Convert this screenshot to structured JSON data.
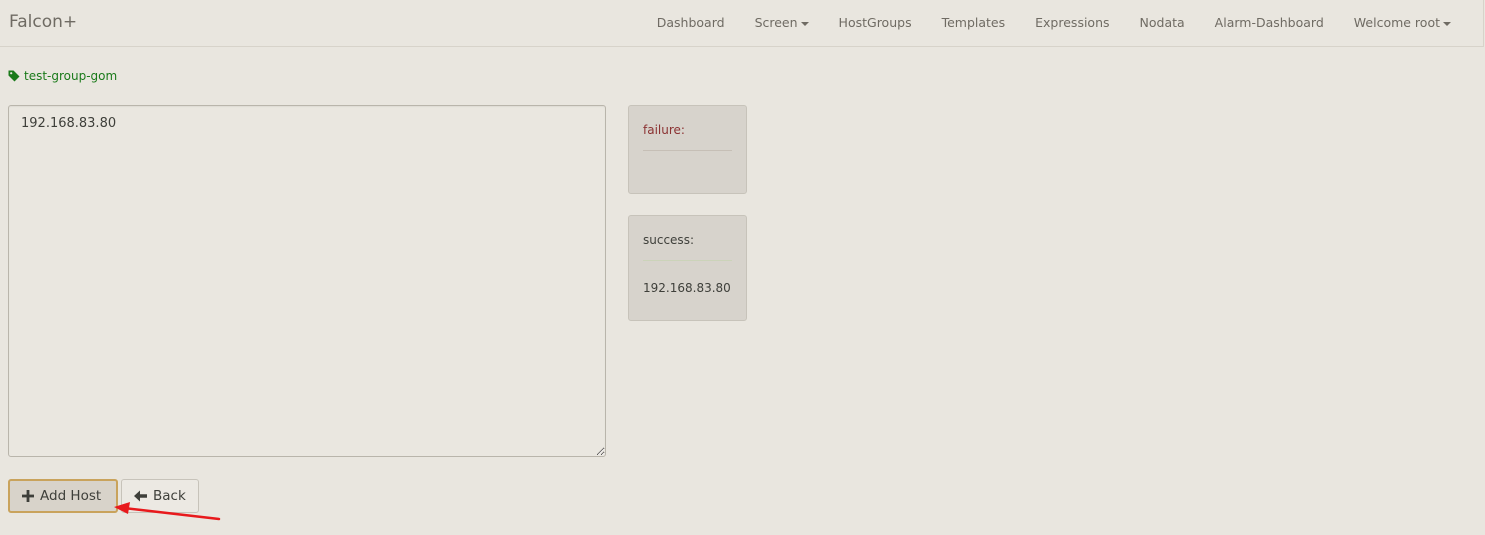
{
  "navbar": {
    "brand": "Falcon+",
    "items": [
      {
        "label": "Dashboard",
        "dropdown": false
      },
      {
        "label": "Screen",
        "dropdown": true
      },
      {
        "label": "HostGroups",
        "dropdown": false
      },
      {
        "label": "Templates",
        "dropdown": false
      },
      {
        "label": "Expressions",
        "dropdown": false
      },
      {
        "label": "Nodata",
        "dropdown": false
      },
      {
        "label": "Alarm-Dashboard",
        "dropdown": false
      },
      {
        "label": "Welcome root",
        "dropdown": true
      }
    ]
  },
  "group": {
    "name": "test-group-gom",
    "icon": "tag-icon",
    "color": "#1a7a1a"
  },
  "hosts_input": {
    "value": "192.168.83.80"
  },
  "results": {
    "failure_label": "failure:",
    "failure_color": "#8b3232",
    "success_label": "success:",
    "success_value": "192.168.83.80"
  },
  "actions": {
    "add_host_label": "Add Host",
    "add_host_icon": "plus-icon",
    "back_label": "Back",
    "back_icon": "arrow-left-icon"
  },
  "annotation": {
    "arrow_color": "#e8191c"
  }
}
